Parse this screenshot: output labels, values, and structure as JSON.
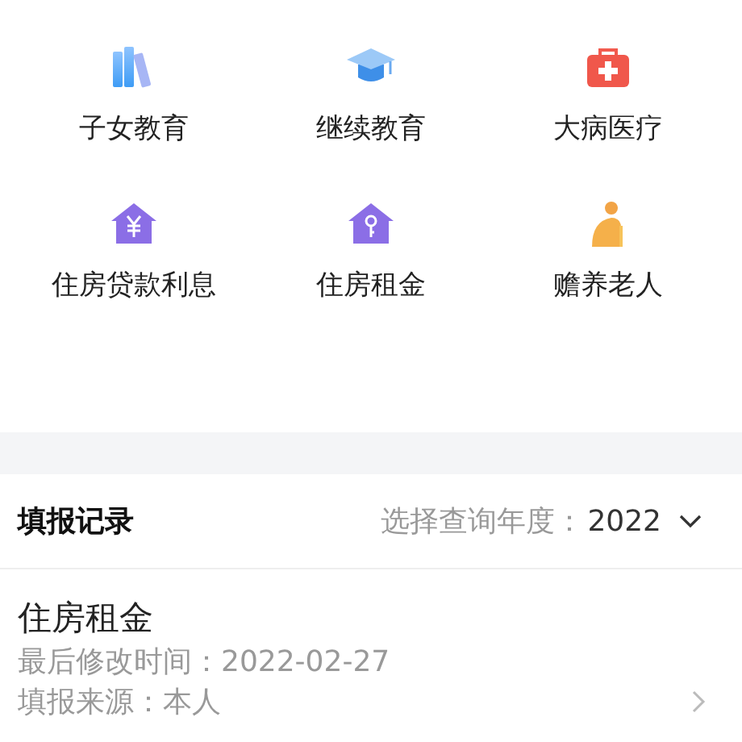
{
  "categories": [
    {
      "label": "子女教育"
    },
    {
      "label": "继续教育"
    },
    {
      "label": "大病医疗"
    },
    {
      "label": "住房贷款利息"
    },
    {
      "label": "住房租金"
    },
    {
      "label": "赡养老人"
    }
  ],
  "records": {
    "title": "填报记录",
    "year_prompt": "选择查询年度：",
    "year": "2022",
    "items": [
      {
        "title": "住房租金",
        "lines": [
          "最后修改时间：2022-02-27",
          "填报来源：本人"
        ]
      }
    ]
  }
}
